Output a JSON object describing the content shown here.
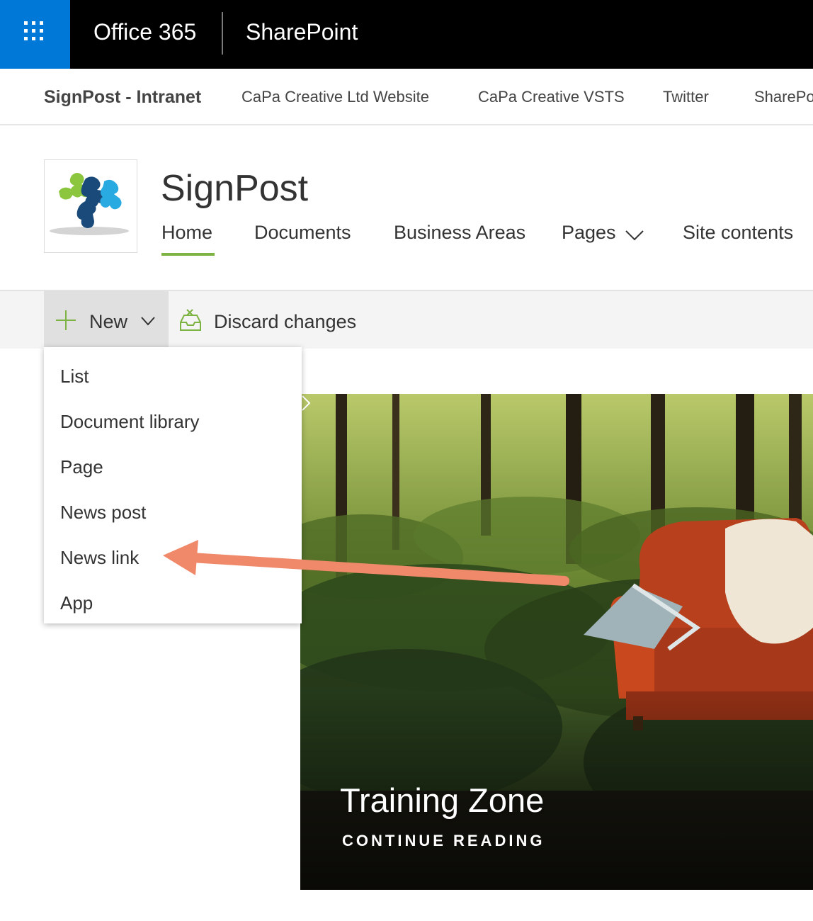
{
  "suite_bar": {
    "app_launcher_icon": "waffle-icon",
    "office_label": "Office 365",
    "app_label": "SharePoint",
    "colors": {
      "background": "#000000",
      "launcher": "#0078d7"
    }
  },
  "hub_nav": {
    "title": "SignPost - Intranet",
    "links": [
      "CaPa Creative Ltd Website",
      "CaPa Creative VSTS",
      "Twitter",
      "SharePoint"
    ]
  },
  "site": {
    "logo_icon": "signpost-puzzle-logo",
    "title": "SignPost",
    "nav": {
      "home": "Home",
      "documents": "Documents",
      "business_areas": "Business Areas",
      "pages": "Pages",
      "site_contents": "Site contents"
    },
    "active_nav": "Home",
    "accent_color": "#7cb342"
  },
  "command_bar": {
    "new_label": "New",
    "new_icon": "plus-icon",
    "discard_label": "Discard changes",
    "discard_icon": "discard-tray-icon"
  },
  "new_menu": {
    "items": [
      "List",
      "Document library",
      "Page",
      "News post",
      "News link",
      "App"
    ],
    "highlighted_item": "News link",
    "annotation_arrow_color": "#f0896a"
  },
  "hero": {
    "title": "Training Zone",
    "link_label": "CONTINUE READING"
  }
}
